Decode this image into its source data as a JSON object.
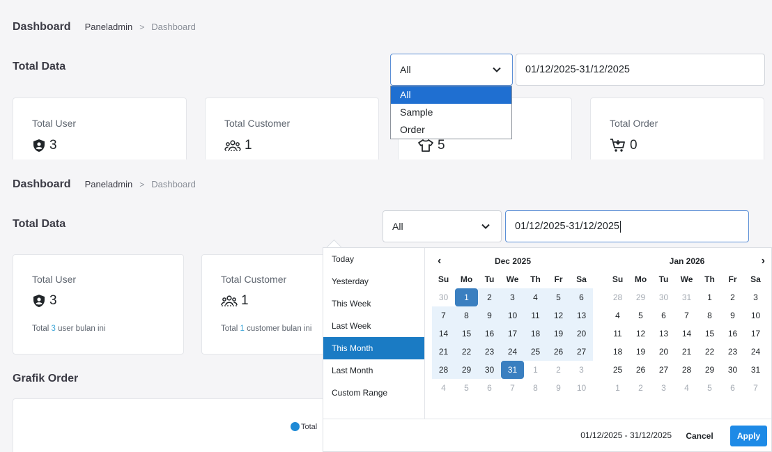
{
  "panel1": {
    "header": {
      "title": "Dashboard",
      "crumb": "Paneladmin",
      "separator": ">",
      "current": "Dashboard"
    },
    "section_title": "Total Data",
    "filter_select": {
      "value": "All",
      "options": [
        "All",
        "Sample",
        "Order"
      ],
      "selected_index": 0
    },
    "date_input": {
      "value": "01/12/2025-31/12/2025"
    },
    "cards": [
      {
        "label": "Total User",
        "value": "3",
        "icon": "user-shield-icon"
      },
      {
        "label": "Total Customer",
        "value": "1",
        "icon": "users-group-icon"
      },
      {
        "label": "",
        "value": "5",
        "icon": "shirt-icon"
      },
      {
        "label": "Total Order",
        "value": "0",
        "icon": "cart-icon"
      }
    ]
  },
  "panel2": {
    "header": {
      "title": "Dashboard",
      "crumb": "Paneladmin",
      "separator": ">",
      "current": "Dashboard"
    },
    "section_title": "Total Data",
    "filter_select": {
      "value": "All"
    },
    "date_input": {
      "value": "01/12/2025-31/12/2025"
    },
    "cards": [
      {
        "label": "Total User",
        "value": "3",
        "icon": "user-shield-icon",
        "note_prefix": "Total ",
        "note_count": "3",
        "note_suffix": " user bulan ini"
      },
      {
        "label": "Total Customer",
        "value": "1",
        "icon": "users-group-icon",
        "note_prefix": "Total ",
        "note_count": "1",
        "note_suffix": " customer bulan ini"
      }
    ],
    "chart_section_title": "Grafik Order",
    "chart_legend": "Total",
    "date_picker": {
      "ranges": [
        "Today",
        "Yesterday",
        "This Week",
        "Last Week",
        "This Month",
        "Last Month",
        "Custom Range"
      ],
      "active_range": "This Month",
      "left_month": "Dec 2025",
      "right_month": "Jan 2026",
      "prev_icon": "chevron-left-icon",
      "next_icon": "chevron-right-icon",
      "weekdays": [
        "Su",
        "Mo",
        "Tu",
        "We",
        "Th",
        "Fr",
        "Sa"
      ],
      "left_days": [
        [
          "30",
          "off"
        ],
        [
          "1",
          "start"
        ],
        [
          "2",
          "in"
        ],
        [
          "3",
          "in"
        ],
        [
          "4",
          "in"
        ],
        [
          "5",
          "in"
        ],
        [
          "6",
          "in"
        ],
        [
          "7",
          "in"
        ],
        [
          "8",
          "in"
        ],
        [
          "9",
          "in"
        ],
        [
          "10",
          "in"
        ],
        [
          "11",
          "in"
        ],
        [
          "12",
          "in"
        ],
        [
          "13",
          "in"
        ],
        [
          "14",
          "in"
        ],
        [
          "15",
          "in"
        ],
        [
          "16",
          "in"
        ],
        [
          "17",
          "in"
        ],
        [
          "18",
          "in"
        ],
        [
          "19",
          "in"
        ],
        [
          "20",
          "in"
        ],
        [
          "21",
          "in"
        ],
        [
          "22",
          "in"
        ],
        [
          "23",
          "in"
        ],
        [
          "24",
          "in"
        ],
        [
          "25",
          "in"
        ],
        [
          "26",
          "in"
        ],
        [
          "27",
          "in"
        ],
        [
          "28",
          "in"
        ],
        [
          "29",
          "in"
        ],
        [
          "30",
          "in"
        ],
        [
          "31",
          "end"
        ],
        [
          "1",
          "off"
        ],
        [
          "2",
          "off"
        ],
        [
          "3",
          "off"
        ],
        [
          "4",
          "off"
        ],
        [
          "5",
          "off"
        ],
        [
          "6",
          "off"
        ],
        [
          "7",
          "off"
        ],
        [
          "8",
          "off"
        ],
        [
          "9",
          "off"
        ],
        [
          "10",
          "off"
        ]
      ],
      "right_days": [
        [
          "28",
          "off"
        ],
        [
          "29",
          "off"
        ],
        [
          "30",
          "off"
        ],
        [
          "31",
          "off"
        ],
        [
          "1",
          "on"
        ],
        [
          "2",
          "on"
        ],
        [
          "3",
          "on"
        ],
        [
          "4",
          "on"
        ],
        [
          "5",
          "on"
        ],
        [
          "6",
          "on"
        ],
        [
          "7",
          "on"
        ],
        [
          "8",
          "on"
        ],
        [
          "9",
          "on"
        ],
        [
          "10",
          "on"
        ],
        [
          "11",
          "on"
        ],
        [
          "12",
          "on"
        ],
        [
          "13",
          "on"
        ],
        [
          "14",
          "on"
        ],
        [
          "15",
          "on"
        ],
        [
          "16",
          "on"
        ],
        [
          "17",
          "on"
        ],
        [
          "18",
          "on"
        ],
        [
          "19",
          "on"
        ],
        [
          "20",
          "on"
        ],
        [
          "21",
          "on"
        ],
        [
          "22",
          "on"
        ],
        [
          "23",
          "on"
        ],
        [
          "24",
          "on"
        ],
        [
          "25",
          "on"
        ],
        [
          "26",
          "on"
        ],
        [
          "27",
          "on"
        ],
        [
          "28",
          "on"
        ],
        [
          "29",
          "on"
        ],
        [
          "30",
          "on"
        ],
        [
          "31",
          "on"
        ],
        [
          "1",
          "off"
        ],
        [
          "2",
          "off"
        ],
        [
          "3",
          "off"
        ],
        [
          "4",
          "off"
        ],
        [
          "5",
          "off"
        ],
        [
          "6",
          "off"
        ],
        [
          "7",
          "off"
        ]
      ],
      "footer_range": "01/12/2025 - 31/12/2025",
      "cancel_label": "Cancel",
      "apply_label": "Apply"
    }
  },
  "colors": {
    "accent": "#1e8ae6",
    "selected_option": "#1f6fd1",
    "range_bg": "#e8f2fb",
    "endpoint": "#3a7fc0",
    "active_range": "#1a7bc4"
  }
}
